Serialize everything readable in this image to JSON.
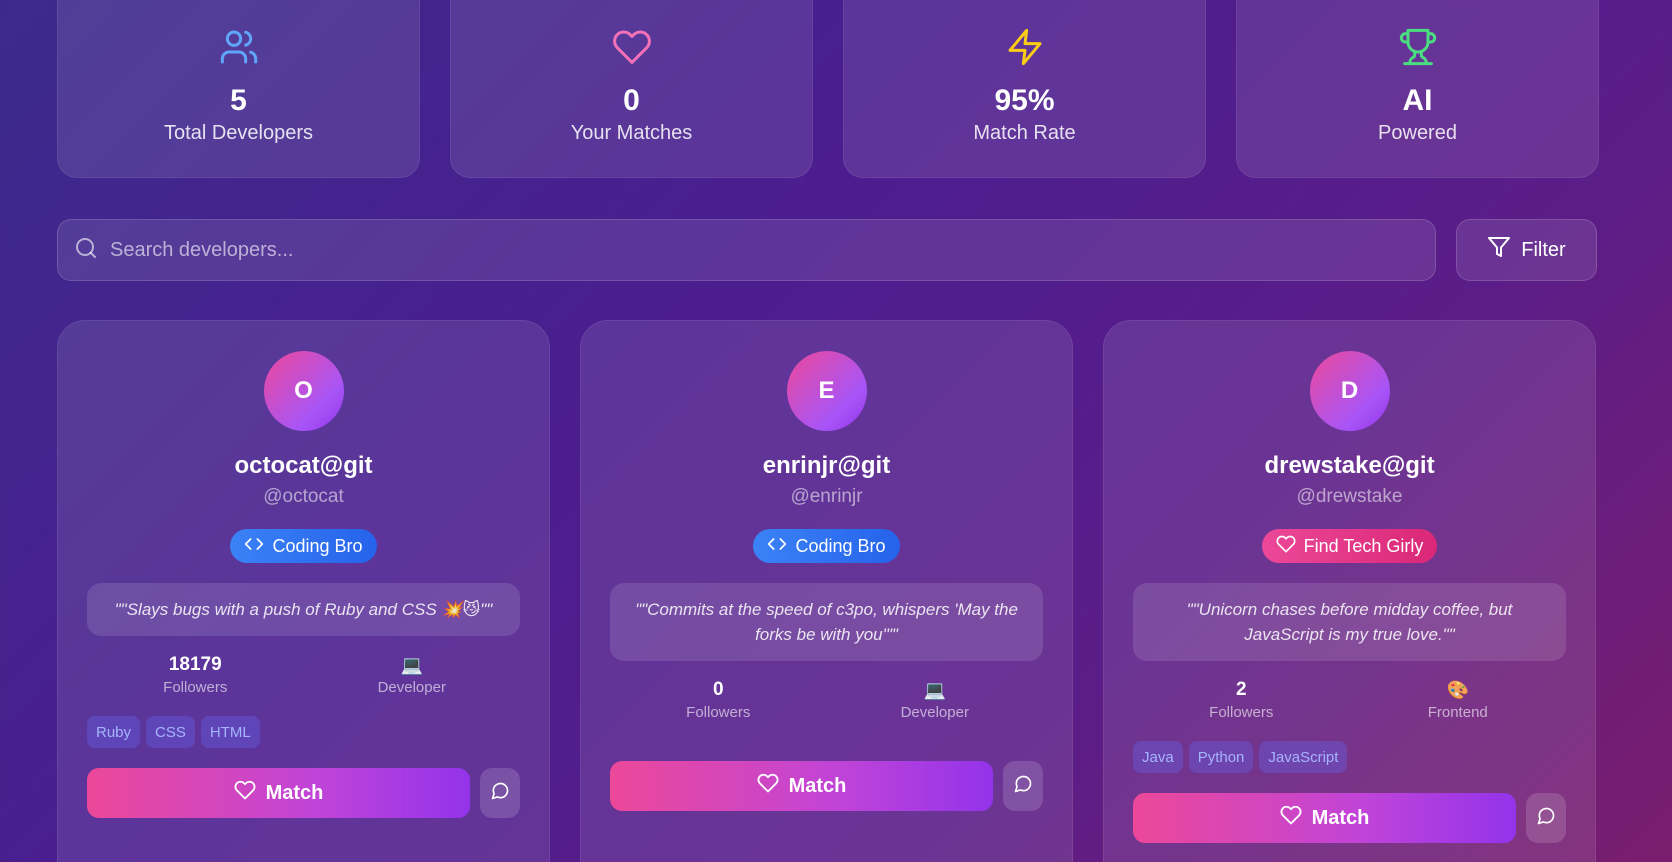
{
  "stats": [
    {
      "value": "5",
      "label": "Total Developers",
      "icon": "users-icon",
      "color": "#60a5fa"
    },
    {
      "value": "0",
      "label": "Your Matches",
      "icon": "heart-icon",
      "color": "#f472b6"
    },
    {
      "value": "95%",
      "label": "Match Rate",
      "icon": "lightning-icon",
      "color": "#facc15"
    },
    {
      "value": "AI",
      "label": "Powered",
      "icon": "trophy-icon",
      "color": "#4ade80"
    }
  ],
  "search": {
    "placeholder": "Search developers...",
    "icon": "search-icon"
  },
  "filter": {
    "label": "Filter",
    "icon": "filter-icon"
  },
  "cards": [
    {
      "initial": "O",
      "name": "octocat@git",
      "handle": "@octocat",
      "badge": "Coding Bro",
      "badge_icon": "code-icon",
      "badge_color": "#3b82f6",
      "quote": "\"\"Slays bugs with a push of Ruby and CSS 💥😼\"\"",
      "followers": "18179",
      "followers_label": "Followers",
      "role_emoji": "💻",
      "role": "Developer",
      "tags": [
        "Ruby",
        "CSS",
        "HTML"
      ],
      "match_label": "Match"
    },
    {
      "initial": "E",
      "name": "enrinjr@git",
      "handle": "@enrinjr",
      "badge": "Coding Bro",
      "badge_icon": "code-icon",
      "badge_color": "#3b82f6",
      "quote": "\"\"Commits at the speed of c3po, whispers 'May the forks be with you'\"\"",
      "followers": "0",
      "followers_label": "Followers",
      "role_emoji": "💻",
      "role": "Developer",
      "tags": [],
      "match_label": "Match"
    },
    {
      "initial": "D",
      "name": "drewstake@git",
      "handle": "@drewstake",
      "badge": "Find Tech Girly",
      "badge_icon": "heart-icon",
      "badge_color": "#ec4899",
      "quote": "\"\"Unicorn chases before midday coffee, but JavaScript is my true love.\"\"",
      "followers": "2",
      "followers_label": "Followers",
      "role_emoji": "🎨",
      "role": "Frontend",
      "tags": [
        "Java",
        "Python",
        "JavaScript"
      ],
      "match_label": "Match"
    }
  ]
}
